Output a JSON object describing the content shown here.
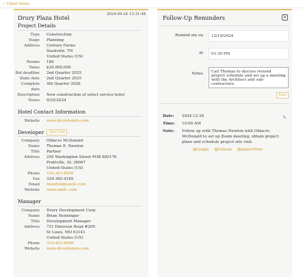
{
  "topbar": {
    "link": "Client Menu"
  },
  "left": {
    "title": "Drury Plaza Hotel",
    "timestamp": "2024-09-24 13:31:48",
    "project_details": {
      "heading": "Project Details",
      "rows": [
        {
          "k": "Type",
          "v": "Construction"
        },
        {
          "k": "Stage",
          "v": "Planning"
        },
        {
          "k": "Address",
          "v": "Century Farms\nNashville, TN\nUnited States (US)"
        },
        {
          "k": "Rooms",
          "v": "180"
        },
        {
          "k": "Value",
          "v": "$30,000,000"
        },
        {
          "k": "Bid deadline",
          "v": "2nd Quarter 2025"
        },
        {
          "k": "State date",
          "v": "2nd Quarter 2025"
        },
        {
          "k": "Complete date",
          "v": "4th Quarter 2026"
        },
        {
          "k": "Description",
          "v": "New construction of select service hotel"
        },
        {
          "k": "Notes",
          "v": "9/25/2024"
        }
      ]
    },
    "hotel_contact": {
      "heading": "Hotel Contact Information",
      "rows": [
        {
          "k": "Website",
          "v": "www.druryhotels.com"
        }
      ]
    },
    "developer": {
      "heading": "Developer",
      "open_label": "Open Chat",
      "rows": [
        {
          "k": "Company",
          "v": "Oldacre McDonald"
        },
        {
          "k": "Name",
          "v": "Thomas E. Newton"
        },
        {
          "k": "Title",
          "v": "Partner"
        },
        {
          "k": "Address",
          "v": "250 Washington Street POB 680176\nPrattville, AL 36067\nUnited States (US)"
        },
        {
          "k": "Phone",
          "v": "334-361-8500"
        },
        {
          "k": "Fax",
          "v": "334-365-4185"
        },
        {
          "k": "Email",
          "v": "tnewton@omllc.com"
        },
        {
          "k": "Website",
          "v": "www.omllc.com"
        }
      ]
    },
    "manager": {
      "heading": "Manager",
      "rows": [
        {
          "k": "Company",
          "v": "Drury Development Corp"
        },
        {
          "k": "Name",
          "v": "Brian Nenninger"
        },
        {
          "k": "Title",
          "v": "Development Manager"
        },
        {
          "k": "Address",
          "v": "721 Emerson Road #200\nSt Louis, MO 63141\nUnited States (US)"
        },
        {
          "k": "Phone",
          "v": "314-423-6698"
        },
        {
          "k": "Website",
          "v": "www.druryhotels.com"
        }
      ]
    }
  },
  "right": {
    "title": "Follow-Up Reminders",
    "form": {
      "remind_label": "Remind me on",
      "remind_value": "12/19/2024",
      "at_label": "At",
      "at_value": "01:30 PM",
      "notes_label": "Notes",
      "notes_value": "Call Thomas to discuss revised project schedule and set up a meeting with the Architect and sub-contractors.",
      "save_label": "Save"
    },
    "entry": {
      "date_label": "Date:",
      "date_value": "2024-12-26",
      "time_label": "Time:",
      "time_value": "10:00 AM",
      "note_label": "Note:",
      "note_value": "Follow up with Thomas Newton with Oldacre McDonald to set up Zoom meeting, obtain project plans and schedule project site visit.",
      "links": [
        "Google",
        "Outlook",
        "Apple/Other"
      ]
    }
  },
  "colors": {
    "accent": "#c8961a",
    "panel_top_border": "#e6c173",
    "panel_bg": "#f6f6f4"
  }
}
